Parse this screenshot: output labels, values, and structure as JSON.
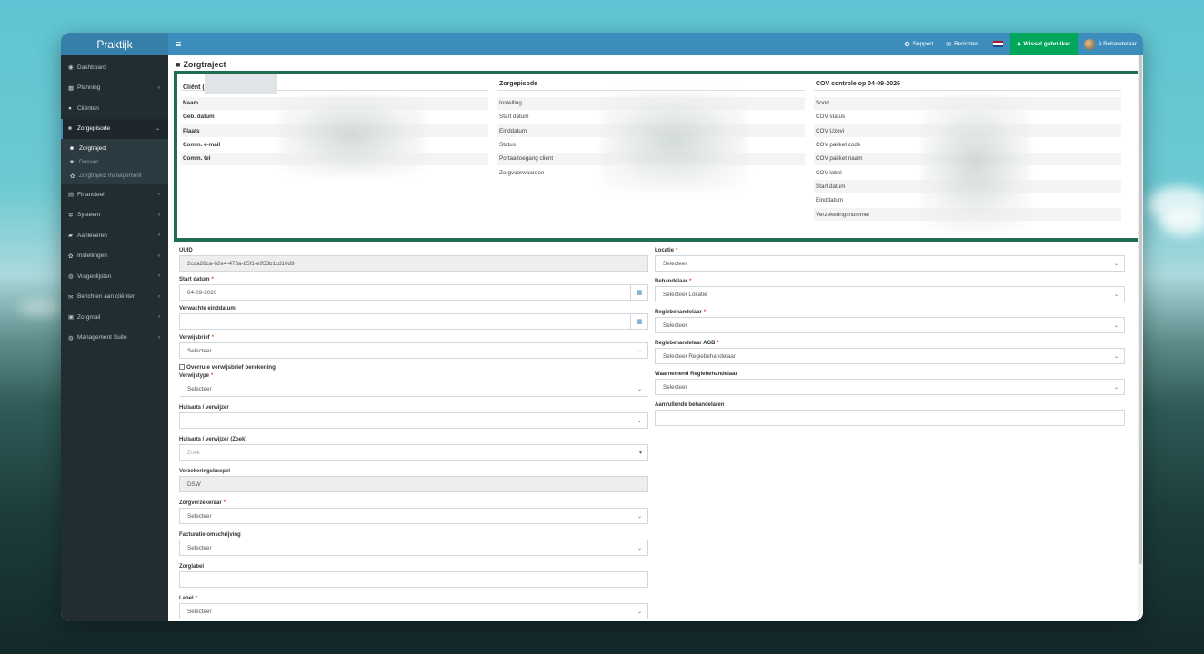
{
  "app": {
    "brand": "Praktijk",
    "menu_toggle": "≡"
  },
  "topbar": {
    "support": "Support",
    "messages": "Berichten",
    "switch_user": "Wissel gebruiker",
    "user": "A Behandelaar"
  },
  "sidebar": {
    "items": [
      {
        "label": "Dashboard",
        "icon": "dashboard-icon",
        "glyph": "◉"
      },
      {
        "label": "Planning",
        "icon": "calendar-icon",
        "glyph": "▦",
        "chevron": "‹"
      },
      {
        "label": "Cliënten",
        "icon": "user-icon",
        "glyph": "●"
      },
      {
        "label": "Zorgepisode",
        "icon": "briefcase-icon",
        "glyph": "■",
        "chevron": "⌄"
      },
      {
        "label": "Financieel",
        "icon": "money-icon",
        "glyph": "▤",
        "chevron": "‹"
      },
      {
        "label": "Systeem",
        "icon": "cogs-icon",
        "glyph": "✲",
        "chevron": "‹"
      },
      {
        "label": "Aanleveren",
        "icon": "truck-icon",
        "glyph": "▰",
        "chevron": "‹"
      },
      {
        "label": "Instellingen",
        "icon": "gear-icon",
        "glyph": "✿",
        "chevron": "‹"
      },
      {
        "label": "Vragenlijsten",
        "icon": "globe-icon",
        "glyph": "◍",
        "chevron": "‹"
      },
      {
        "label": "Berichten aan cliënten",
        "icon": "envelope-icon",
        "glyph": "✉",
        "chevron": "‹"
      },
      {
        "label": "Zorgmail",
        "icon": "envelope-square-icon",
        "glyph": "▣",
        "chevron": "‹"
      },
      {
        "label": "Management Suite",
        "icon": "globe-icon",
        "glyph": "◍",
        "chevron": "‹"
      }
    ],
    "submenu": [
      {
        "label": "Zorgtraject",
        "glyph": "■"
      },
      {
        "label": "Dossier",
        "glyph": "■"
      },
      {
        "label": "Zorgtraject management",
        "glyph": "✿"
      }
    ]
  },
  "page": {
    "title": "Zorgtraject"
  },
  "info": {
    "client": {
      "heading": "Cliënt (",
      "rows": [
        "Naam",
        "Geb. datum",
        "Plaats",
        "Comm. e-mail",
        "Comm. tel"
      ]
    },
    "episode": {
      "heading": "Zorgepisode",
      "rows": [
        "Instelling",
        "Start datum",
        "Einddatum",
        "Status",
        "Portaaltoegang client",
        "Zorgvoorwaarden"
      ]
    },
    "cov": {
      "heading": "COV controle op 04-09-2026",
      "rows": [
        "Soort",
        "COV status",
        "COV Uzovi",
        "COV pakket code",
        "COV pakket naam",
        "COV label",
        "Start datum",
        "Einddatum",
        "Verzekeringsnummer"
      ]
    }
  },
  "form": {
    "uuid_label": "UUID",
    "uuid_value": "2cda28ca-62e4-473a-b5f1-e953b1cd10d9",
    "start_label": "Start datum",
    "start_value": "04-09-2026",
    "expected_end_label": "Verwachte einddatum",
    "referral_label": "Verwijsbrief",
    "override_label": "Overrule verwijsbrief berekening",
    "referral_type_label": "Verwijstype",
    "gp_label": "Huisarts / verwijzer",
    "gp_search_label": "Huisarts / verwijzer (Zoek)",
    "gp_search_placeholder": "Zoek",
    "insurance_group_label": "Verzekeringskoepel",
    "insurance_group_value": "DSW",
    "insurer_label": "Zorgverzekeraar",
    "billing_label": "Facturatie omschrijving",
    "care_label_label": "Zorglabel",
    "label_label": "Label",
    "location_label": "Locatie",
    "practitioner_label": "Behandelaar",
    "practitioner_value": "Selecteer Lokatie",
    "director_label": "Regiebehandelaar",
    "director_agb_label": "Regiebehandelaar AGB",
    "director_agb_value": "Selecteer Regiebehandelaar",
    "acting_director_label": "Waarnemend Regiebehandelaar",
    "extra_practitioners_label": "Aanvullende behandelaren",
    "select": "Selecteer",
    "required": "*"
  }
}
